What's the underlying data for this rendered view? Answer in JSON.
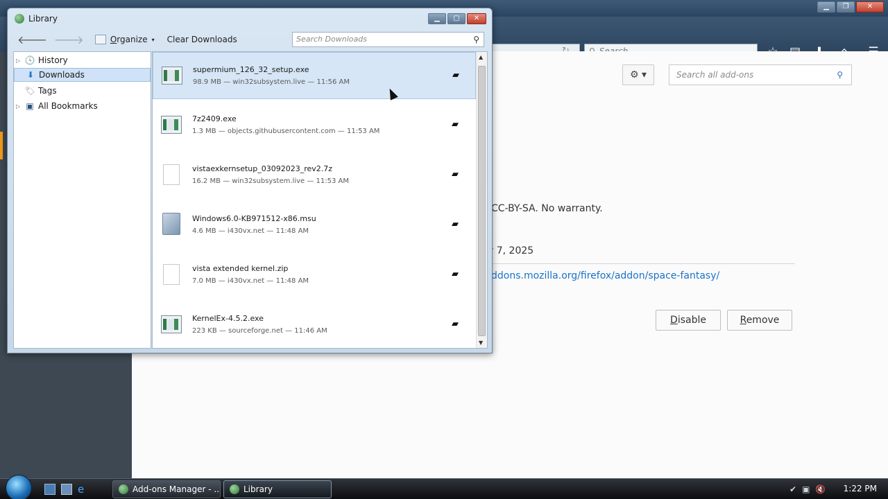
{
  "background_window": {
    "browser_search_placeholder": "Search",
    "addons_search_placeholder": "Search all add-ons",
    "license_text": "CC-BY-SA. No warranty.",
    "date_fragment": "y 7, 2025",
    "homepage_link": "ddons.mozilla.org/firefox/addon/space-fantasy/",
    "disable_label": "Disable",
    "remove_label": "Remove"
  },
  "library": {
    "title": "Library",
    "toolbar": {
      "organize_label": "Organize",
      "clear_downloads_label": "Clear Downloads",
      "search_placeholder": "Search Downloads"
    },
    "tree": [
      {
        "label": "History",
        "icon": "clock-icon"
      },
      {
        "label": "Downloads",
        "icon": "download-arrow-icon"
      },
      {
        "label": "Tags",
        "icon": "tag-icon"
      },
      {
        "label": "All Bookmarks",
        "icon": "bookmarks-icon"
      }
    ],
    "downloads": [
      {
        "name": "supermium_126_32_setup.exe",
        "meta": "98.9 MB — win32subsystem.live — 11:56 AM"
      },
      {
        "name": "7z2409.exe",
        "meta": "1.3 MB — objects.githubusercontent.com — 11:53 AM"
      },
      {
        "name": "vistaexkernsetup_03092023_rev2.7z",
        "meta": "16.2 MB — win32subsystem.live — 11:53 AM"
      },
      {
        "name": "Windows6.0-KB971512-x86.msu",
        "meta": "4.6 MB — i430vx.net — 11:48 AM"
      },
      {
        "name": "vista extended kernel.zip",
        "meta": "7.0 MB — i430vx.net — 11:48 AM"
      },
      {
        "name": "KernelEx-4.5.2.exe",
        "meta": "223 KB — sourceforge.net — 11:46 AM"
      }
    ]
  },
  "taskbar": {
    "tasks": [
      "Add-ons Manager - ...",
      "Library"
    ],
    "clock": "1:22 PM"
  }
}
